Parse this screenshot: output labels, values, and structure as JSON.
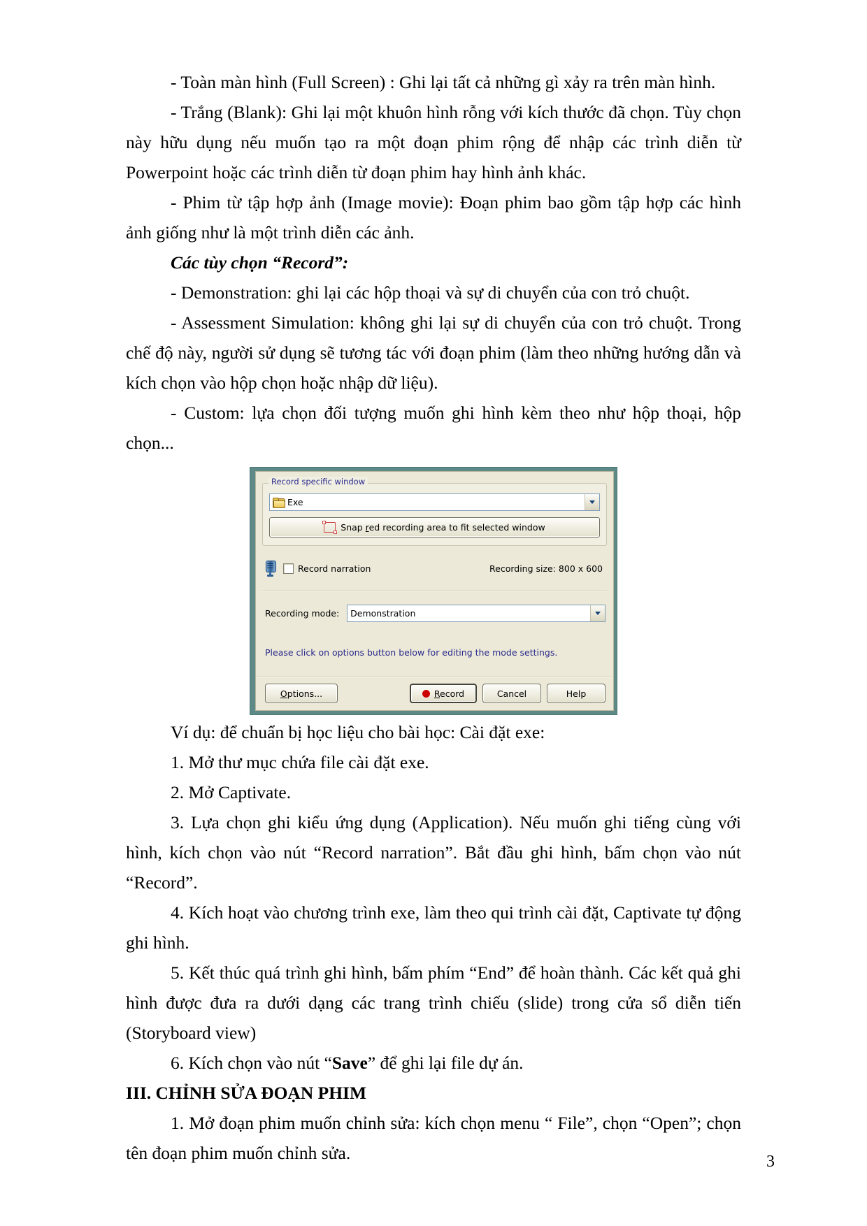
{
  "document": {
    "page_number": "3",
    "paragraphs": [
      {
        "id": "p1",
        "style": "indent",
        "text": "- Toàn màn hình (Full Screen) : Ghi lại tất cả những gì xảy ra trên màn hình."
      },
      {
        "id": "p2",
        "style": "indent",
        "text": "- Trắng (Blank): Ghi lại một khuôn hình rỗng với kích thước đã chọn. Tùy chọn này hữu dụng nếu muốn tạo ra một đoạn phim rộng để nhập các trình diễn từ Powerpoint hoặc các trình diễn từ đoạn phim hay hình ảnh khác."
      },
      {
        "id": "p3",
        "style": "indent",
        "text": "- Phim từ tập hợp ảnh (Image movie): Đoạn phim bao gồm tập hợp các hình ảnh giống như là một trình diễn các ảnh."
      },
      {
        "id": "p4",
        "style": "heading-italic",
        "text": "Các tùy chọn “Record”:"
      },
      {
        "id": "p5",
        "style": "indent",
        "text": "- Demonstration: ghi lại các hộp thoại và sự di chuyển của con trỏ chuột."
      },
      {
        "id": "p6",
        "style": "indent",
        "text": "- Assessment Simulation: không ghi lại sự di chuyển của con trỏ chuột. Trong chế độ này, người sử dụng sẽ tương tác với đoạn phim (làm theo những hướng dẫn và kích chọn vào hộp chọn hoặc nhập dữ liệu)."
      },
      {
        "id": "p7",
        "style": "indent",
        "text": "- Custom: lựa chọn đối tượng muốn ghi hình kèm theo như hộp thoại, hộp chọn..."
      }
    ],
    "paragraphs_after": [
      {
        "id": "p8",
        "style": "indent",
        "text": "Ví dụ: để chuẩn bị học liệu cho bài học: Cài đặt exe:"
      },
      {
        "id": "p9",
        "style": "indent",
        "text": "1. Mở thư mục chứa file cài đặt exe."
      },
      {
        "id": "p10",
        "style": "indent",
        "text": "2. Mở Captivate."
      },
      {
        "id": "p11",
        "style": "indent",
        "text": "3. Lựa chọn ghi kiểu ứng dụng (Application). Nếu muốn ghi tiếng cùng với hình, kích chọn vào nút “Record narration”. Bắt đầu ghi hình, bấm chọn vào nút “Record”."
      },
      {
        "id": "p12",
        "style": "indent",
        "text": "4. Kích hoạt vào chương trình exe, làm theo qui trình cài đặt, Captivate tự động ghi hình."
      },
      {
        "id": "p13",
        "style": "indent",
        "text": "5. Kết thúc quá trình ghi hình, bấm phím “End” để hoàn thành. Các kết quả ghi hình được đưa ra dưới dạng các trang trình chiếu (slide) trong cửa sổ diễn tiến (Storyboard view)"
      }
    ],
    "paragraph_save": {
      "prefix": "6. Kích chọn vào nút “",
      "bold": "Save",
      "suffix": "” để ghi lại file dự án."
    },
    "section_heading": "III. CHỈNH SỬA ĐOẠN PHIM",
    "paragraphs_tail": [
      {
        "id": "p15",
        "style": "indent",
        "text": "1. Mở đoạn phim muốn chỉnh sửa: kích chọn menu “ File”, chọn “Open”; chọn tên đoạn phim muốn chỉnh sửa."
      }
    ]
  },
  "dialog": {
    "group_title": "Record specific window",
    "window_combo_value": "Exe",
    "snap_button": {
      "pre": "Snap ",
      "accel": "r",
      "post": "ed recording area to fit selected window"
    },
    "narration_label": "Record narration",
    "narration_checked": false,
    "recording_size_label": "Recording size: 800 x 600",
    "mode_label": "Recording mode:",
    "mode_value": "Demonstration",
    "hint_text": "Please click on options button below for editing the mode settings.",
    "buttons": {
      "options": {
        "pre": "",
        "accel": "O",
        "post": "ptions..."
      },
      "record": {
        "pre": "",
        "accel": "R",
        "post": "ecord"
      },
      "cancel": "Cancel",
      "help": "Help"
    },
    "colors": {
      "frame": "#5d8a86",
      "face": "#ece9d8",
      "group_face": "#f1efe2",
      "label_blue": "#2a2a8c",
      "record_dot_red": "#cc0000",
      "snap_outline_red": "#d04a4a"
    }
  }
}
